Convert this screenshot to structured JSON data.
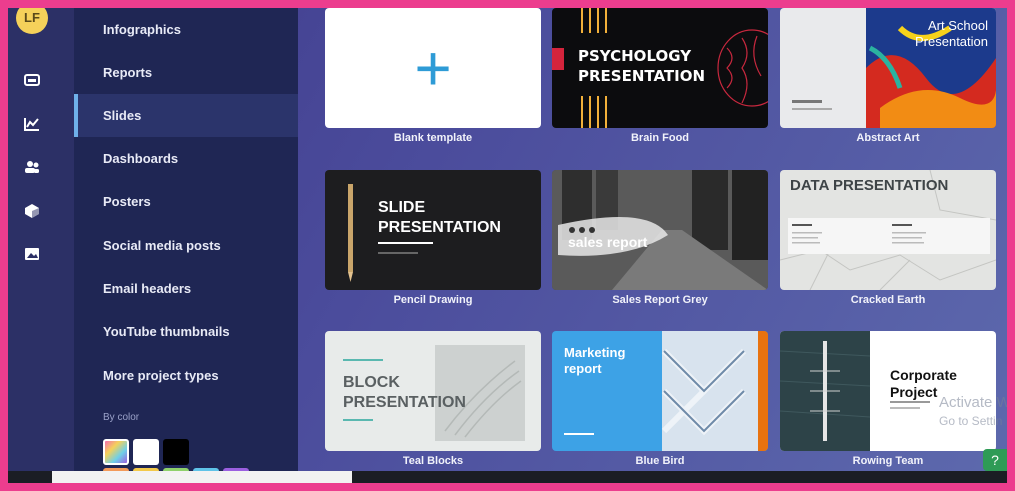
{
  "user": {
    "initials": "LF"
  },
  "rail_icons": [
    "template-icon",
    "chart-icon",
    "team-icon",
    "brand-kit-icon",
    "image-icon"
  ],
  "categories": [
    {
      "label": "Infographics"
    },
    {
      "label": "Reports"
    },
    {
      "label": "Slides",
      "active": true
    },
    {
      "label": "Dashboards"
    },
    {
      "label": "Posters"
    },
    {
      "label": "Social media posts"
    },
    {
      "label": "Email headers"
    },
    {
      "label": "YouTube thumbnails"
    },
    {
      "label": "More project types"
    }
  ],
  "by_color": {
    "label": "By color",
    "swatches": [
      "#f3b1d4",
      "#ffffff",
      "#000000"
    ],
    "swatches_row2": [
      "#f39a5a",
      "#f3c94a",
      "#8fd16b",
      "#5fc3e8",
      "#9b5fe0"
    ]
  },
  "templates": [
    {
      "name": "Blank template",
      "thumb_text": "+"
    },
    {
      "name": "Brain Food",
      "thumb_text": "PSYCHOLOGY PRESENTATION"
    },
    {
      "name": "Abstract Art",
      "thumb_text": "Art School Presentation"
    },
    {
      "name": "Pencil Drawing",
      "thumb_text": "SLIDE PRESENTATION"
    },
    {
      "name": "Sales Report Grey",
      "thumb_text": "sales report"
    },
    {
      "name": "Cracked Earth",
      "thumb_text": "DATA PRESENTATION"
    },
    {
      "name": "Teal Blocks",
      "thumb_text": "BLOCK PRESENTATION"
    },
    {
      "name": "Blue Bird",
      "thumb_text": "Marketing report"
    },
    {
      "name": "Rowing Team",
      "thumb_text": "Corporate Project"
    }
  ],
  "overlay": {
    "activate_line1": "Activate W",
    "activate_line2": "Go to Settin",
    "help": "?"
  },
  "colors": {
    "accent": "#2e9bd6",
    "active_border": "#6fb0e9",
    "help_green": "#2e9b56"
  }
}
